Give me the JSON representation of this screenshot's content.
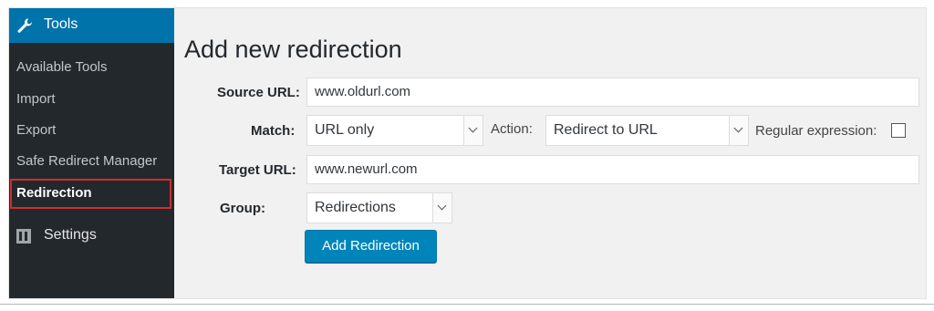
{
  "sidebar": {
    "section_title": "Tools",
    "items": [
      {
        "label": "Available Tools",
        "active": false
      },
      {
        "label": "Import",
        "active": false
      },
      {
        "label": "Export",
        "active": false
      },
      {
        "label": "Safe Redirect Manager",
        "active": false
      },
      {
        "label": "Redirection",
        "active": true
      }
    ],
    "settings_label": "Settings"
  },
  "page": {
    "title": "Add new redirection"
  },
  "form": {
    "source_url_label": "Source URL:",
    "source_url_value": "www.oldurl.com",
    "match_label": "Match:",
    "match_value": "URL only",
    "action_label": "Action:",
    "action_value": "Redirect to URL",
    "regex_label": "Regular expression:",
    "regex_checked": false,
    "target_url_label": "Target URL:",
    "target_url_value": "www.newurl.com",
    "group_label": "Group:",
    "group_value": "Redirections",
    "submit_label": "Add Redirection"
  },
  "colors": {
    "sidebar_bg": "#23282d",
    "accent": "#0073aa",
    "button": "#0085ba",
    "highlight_border": "#cf2e2e"
  }
}
